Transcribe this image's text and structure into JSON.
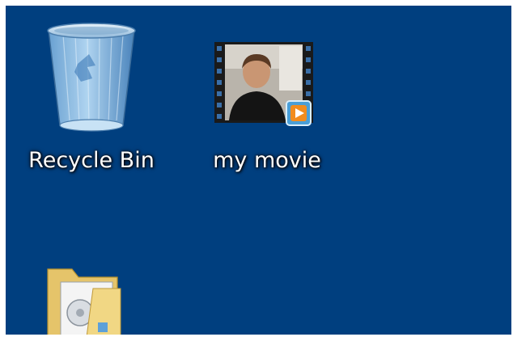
{
  "desktop": {
    "background_color": "#003f7f",
    "icons": [
      {
        "label": "Recycle Bin",
        "icon": "recycle-bin-icon"
      },
      {
        "label": "my movie",
        "icon": "video-file-icon"
      },
      {
        "label": "",
        "icon": "folder-icon"
      }
    ]
  }
}
